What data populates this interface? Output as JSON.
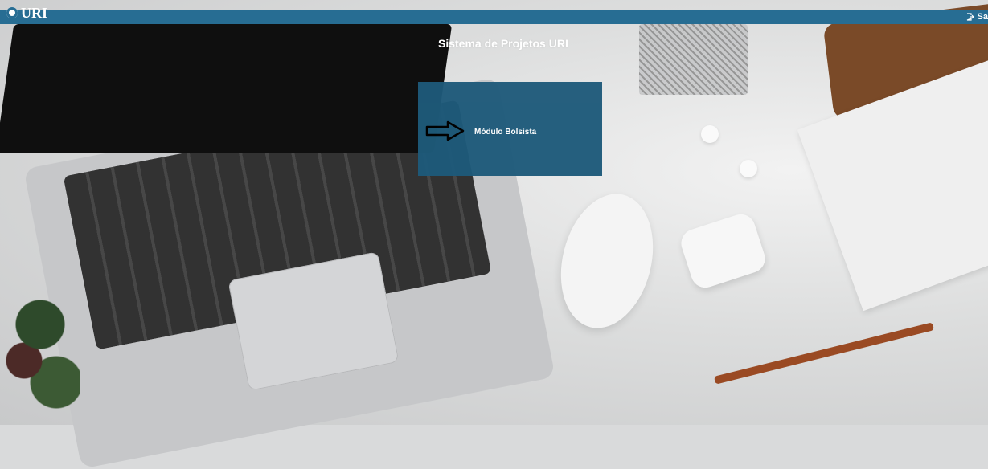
{
  "header": {
    "logo_text": "URI",
    "logout_label": "Sa"
  },
  "main": {
    "system_title": "Sistema de Projetos URI",
    "modules": [
      {
        "label": "Módulo Bolsista"
      }
    ]
  },
  "colors": {
    "topbar": "#276d93",
    "module_card": "#1e5a7a"
  },
  "icons": {
    "logo": "uri-seal-icon",
    "logout": "logout-icon",
    "module_arrow": "arrow-right-outline-icon"
  }
}
